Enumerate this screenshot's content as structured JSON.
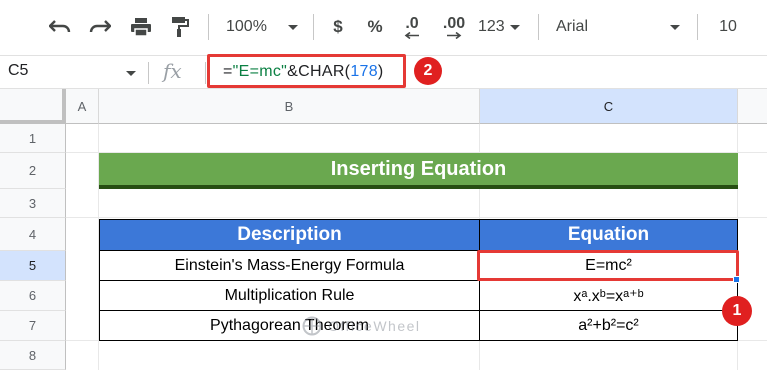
{
  "toolbar": {
    "zoom": "100%",
    "currency": "$",
    "percent": "%",
    "decrease_decimals": ".0",
    "increase_decimals": ".00",
    "number_format": "123",
    "font": "Arial",
    "font_size": "10",
    "icons": [
      "undo-icon",
      "redo-icon",
      "print-icon",
      "paint-format-icon"
    ]
  },
  "formula_bar": {
    "cell_ref": "C5",
    "fx_label": "fx",
    "formula_prefix": "=",
    "formula_string": "\"E=mc\"",
    "formula_middle": "&CHAR(",
    "formula_number": "178",
    "formula_suffix": ")"
  },
  "annotations": {
    "badge_1": "1",
    "badge_2": "2"
  },
  "grid": {
    "columns": [
      "A",
      "B",
      "C"
    ],
    "rows": [
      "1",
      "2",
      "3",
      "4",
      "5",
      "6",
      "7",
      "8"
    ],
    "active_cell": "C5"
  },
  "sheet": {
    "title": "Inserting Equation",
    "headers": {
      "description": "Description",
      "equation": "Equation"
    },
    "rows": [
      {
        "description": "Einstein's Mass-Energy Formula",
        "equation": "E=mc²"
      },
      {
        "description": "Multiplication Rule",
        "equation": "xᵃ.xᵇ=xᵃ⁺ᵇ"
      },
      {
        "description": "Pythagorean Theorem",
        "equation": "a²+b²=c²"
      }
    ]
  },
  "watermark": "OfficeWheel",
  "colors": {
    "title_fill": "#6aa84f",
    "header_fill": "#3c78d8",
    "highlight_red": "#e53935",
    "selection_blue": "#1a73e8"
  }
}
